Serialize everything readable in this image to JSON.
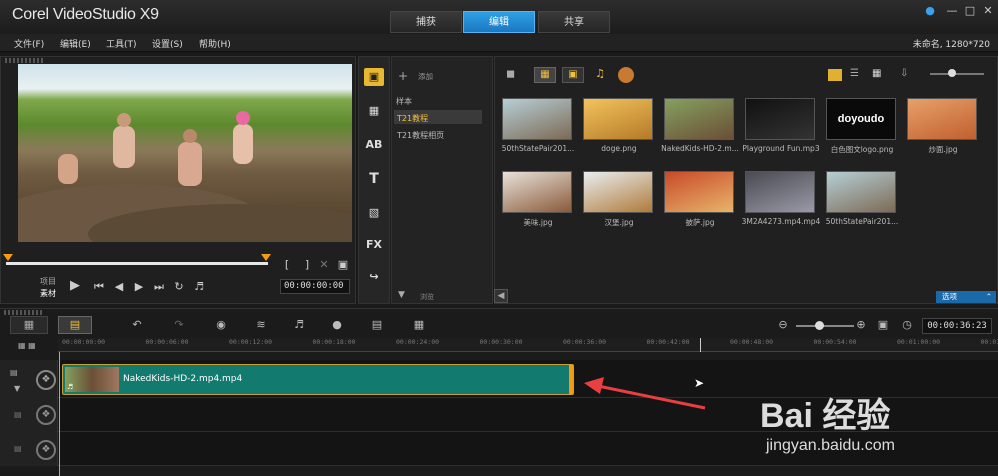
{
  "app": {
    "title": "Corel VideoStudio X9"
  },
  "mode_tabs": [
    {
      "label": "捕获"
    },
    {
      "label": "编辑"
    },
    {
      "label": "共享"
    }
  ],
  "menu": [
    {
      "label": "文件(F)"
    },
    {
      "label": "编辑(E)"
    },
    {
      "label": "工具(T)"
    },
    {
      "label": "设置(S)"
    },
    {
      "label": "帮助(H)"
    }
  ],
  "project_info": "未命名, 1280*720",
  "player": {
    "mode_labels": [
      "项目",
      "素材"
    ],
    "timecode": "00:00:00:00"
  },
  "library": {
    "add_label": "添加",
    "browse_label": "浏览",
    "folders": [
      {
        "label": "样本"
      },
      {
        "label": "T21教程",
        "selected": true
      },
      {
        "label": "T21教程相页"
      }
    ],
    "options_label": "选项",
    "items": [
      {
        "name": "50thStatePair201...",
        "color1": "#b6cfd6",
        "color2": "#7d6a55"
      },
      {
        "name": "doge.png",
        "color1": "#f2c35c",
        "color2": "#b57a28"
      },
      {
        "name": "NakedKids-HD-2.m...",
        "color1": "#86a060",
        "color2": "#6a4f36"
      },
      {
        "name": "Playground Fun.mp3",
        "color1": "#111111",
        "color2": "#333333"
      },
      {
        "name": "白色图文logo.png",
        "color1": "#0a0a0a",
        "color2": "#0a0a0a",
        "logo_text": "doyoudo"
      },
      {
        "name": "炒面.jpg",
        "color1": "#e8a06a",
        "color2": "#c0602e"
      },
      {
        "name": "美味.jpg",
        "color1": "#e8e2da",
        "color2": "#8a5a3a"
      },
      {
        "name": "汉堡.jpg",
        "color1": "#e8eef0",
        "color2": "#b07a3a"
      },
      {
        "name": "披萨.jpg",
        "color1": "#c84a2a",
        "color2": "#e8b46a"
      },
      {
        "name": "3M2A4273.mp4.mp4",
        "color1": "#4a4a52",
        "color2": "#9a9aa8"
      },
      {
        "name": "50thStatePair201...",
        "color1": "#b6cfd6",
        "color2": "#7d6a55"
      }
    ]
  },
  "timeline": {
    "timecode": "00:00:36:23",
    "ruler": [
      "00:00:00:00",
      "00:00:06:00",
      "00:00:12:00",
      "00:00:18:00",
      "00:00:24:00",
      "00:00:30:00",
      "00:00:36:00",
      "00:00:42:00",
      "00:00:48:00",
      "00:00:54:00",
      "00:01:00:00",
      "00:01:06:00"
    ],
    "clip_label": "NakedKids-HD-2.mp4.mp4"
  },
  "watermark": {
    "brand": "Bai 经验",
    "url": "jingyan.baidu.com"
  },
  "colors": {
    "accent": "#1a88d6",
    "clip": "#127a6e",
    "arrow": "#e84040"
  }
}
